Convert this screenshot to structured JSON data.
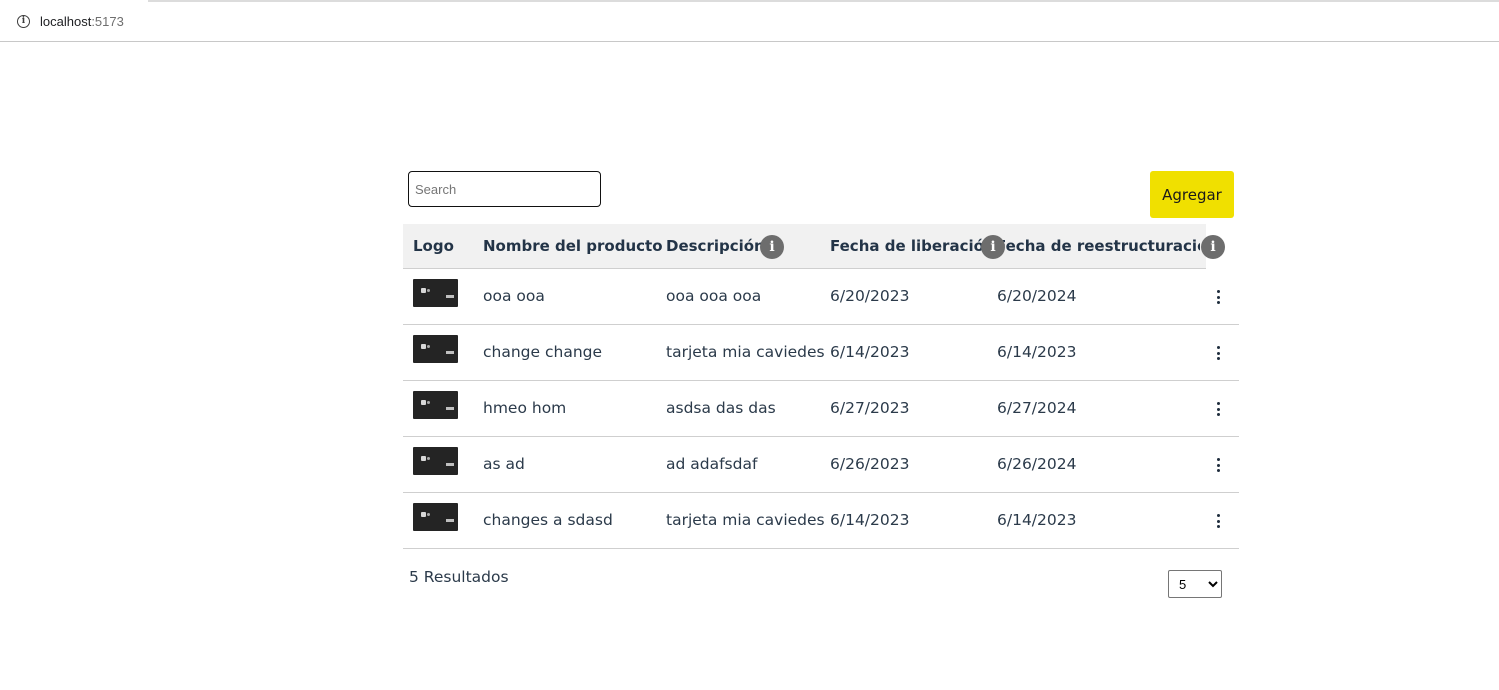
{
  "browser": {
    "url_host": "localhost",
    "url_port": ":5173"
  },
  "toolbar": {
    "search_placeholder": "Search",
    "add_label": "Agregar"
  },
  "table": {
    "headers": {
      "logo": "Logo",
      "name": "Nombre del producto",
      "description": "Descripción",
      "release": "Fecha de liberación",
      "restructure": "Fecha de reestructuración"
    },
    "hint_glyph": "i",
    "rows": [
      {
        "name": "ooa ooa",
        "description": "ooa ooa ooa",
        "release": "6/20/2023",
        "restructure": "6/20/2024"
      },
      {
        "name": "change change",
        "description": "tarjeta mia caviedes",
        "release": "6/14/2023",
        "restructure": "6/14/2023"
      },
      {
        "name": "hmeo hom",
        "description": "asdsa das das",
        "release": "6/27/2023",
        "restructure": "6/27/2024"
      },
      {
        "name": "as ad",
        "description": "ad adafsdaf",
        "release": "6/26/2023",
        "restructure": "6/26/2024"
      },
      {
        "name": "changes a sdasd",
        "description": "tarjeta mia caviedes",
        "release": "6/14/2023",
        "restructure": "6/14/2023"
      }
    ]
  },
  "footer": {
    "results_label": "5 Resultados",
    "page_size_value": "5",
    "page_size_options": [
      "5"
    ]
  },
  "colors": {
    "accent": "#f0e000",
    "header_bg": "#f1f1f1",
    "text": "#233447"
  }
}
